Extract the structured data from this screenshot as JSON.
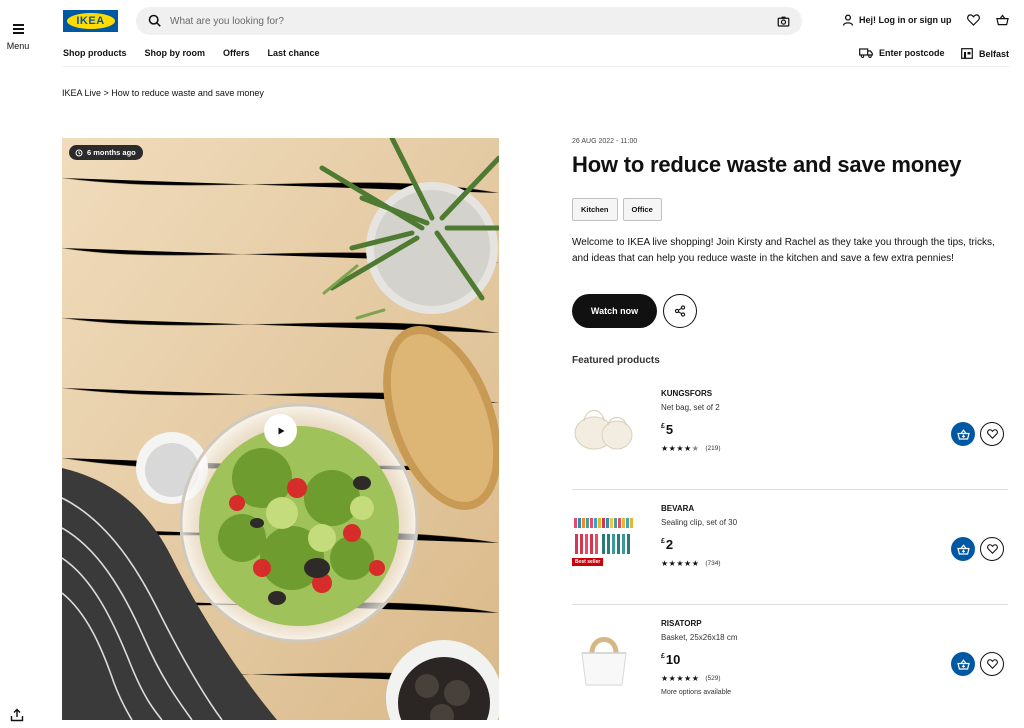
{
  "header": {
    "menu_label": "Menu",
    "logo_text": "IKEA",
    "search_placeholder": "What are you looking for?",
    "login_label": "Hej! Log in or sign up",
    "nav": [
      "Shop products",
      "Shop by room",
      "Offers",
      "Last chance"
    ],
    "postcode_label": "Enter postcode",
    "store_label": "Belfast"
  },
  "breadcrumb": "IKEA Live > How to reduce waste and save money",
  "video": {
    "time_badge": "6 months ago"
  },
  "event": {
    "datetime": "26 AUG 2022 - 11:00",
    "title": "How to reduce waste and save money",
    "tags": [
      "Kitchen",
      "Office"
    ],
    "description": "Welcome to IKEA live shopping! Join Kirsty and Rachel as they take you through the tips, tricks, and ideas that can help you reduce waste in the kitchen and save a few extra pennies!",
    "watch_label": "Watch now",
    "featured_heading": "Featured products"
  },
  "products": [
    {
      "name": "KUNGSFORS",
      "description": "Net bag, set of 2",
      "currency": "£",
      "price": "5",
      "rating": 4.5,
      "reviews": "(219)",
      "badge": "",
      "more": ""
    },
    {
      "name": "BEVARA",
      "description": "Sealing clip, set of 30",
      "currency": "£",
      "price": "2",
      "rating": 5,
      "reviews": "(734)",
      "badge": "Best seller",
      "more": ""
    },
    {
      "name": "RISATORP",
      "description": "Basket, 25x26x18 cm",
      "currency": "£",
      "price": "10",
      "rating": 5,
      "reviews": "(529)",
      "badge": "",
      "more": "More options available"
    }
  ],
  "colors": {
    "brand_blue": "#0058a3",
    "brand_yellow": "#ffdb00",
    "bestseller_red": "#cc0008"
  }
}
